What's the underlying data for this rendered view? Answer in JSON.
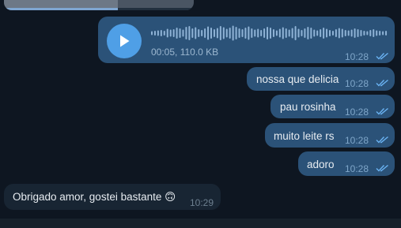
{
  "chat": {
    "top_media": {
      "playback_progress": 0.6
    },
    "voice_message": {
      "meta": "00:05, 110.0 KB",
      "time": "10:28",
      "status": "read",
      "waveform_levels": [
        0.25,
        0.3,
        0.35,
        0.4,
        0.3,
        0.55,
        0.45,
        0.5,
        0.7,
        0.6,
        0.45,
        0.8,
        0.9,
        0.6,
        0.75,
        0.5,
        0.4,
        0.6,
        0.85,
        0.7,
        0.5,
        0.65,
        0.9,
        0.75,
        0.55,
        0.7,
        0.95,
        0.8,
        0.6,
        0.5,
        0.7,
        0.85,
        0.6,
        0.45,
        0.55,
        0.4,
        0.6,
        0.8,
        0.7,
        0.5,
        0.35,
        0.55,
        0.75,
        0.6,
        0.45,
        0.65,
        0.9,
        0.55,
        0.4,
        0.6,
        0.8,
        0.7,
        0.45,
        0.35,
        0.5,
        0.7,
        0.55,
        0.4,
        0.3,
        0.5,
        0.65,
        0.55,
        0.4,
        0.35,
        0.45,
        0.6,
        0.5,
        0.4,
        0.3,
        0.25,
        0.4,
        0.5,
        0.35,
        0.3,
        0.25,
        0.3
      ]
    },
    "messages": [
      {
        "text": "nossa que delicia",
        "time": "10:28",
        "direction": "out",
        "status": "read"
      },
      {
        "text": "pau rosinha",
        "time": "10:28",
        "direction": "out",
        "status": "read"
      },
      {
        "text": "muito leite rs",
        "time": "10:28",
        "direction": "out",
        "status": "read"
      },
      {
        "text": "adoro",
        "time": "10:28",
        "direction": "out",
        "status": "read"
      },
      {
        "text": "Obrigado amor, gostei bastante 🙃",
        "time": "10:29",
        "direction": "in"
      }
    ]
  },
  "colors": {
    "background": "#0e1621",
    "outgoing_bubble": "#2b5278",
    "incoming_bubble": "#182533",
    "play_button": "#4f9fe6",
    "read_ticks": "#6ab3f3"
  }
}
